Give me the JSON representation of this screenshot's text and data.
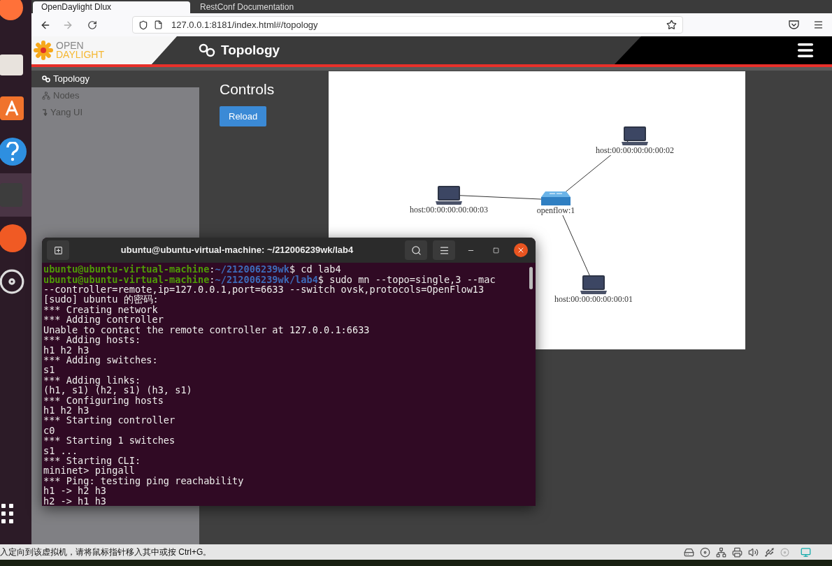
{
  "browser": {
    "tabs": [
      {
        "label": "OpenDaylight Dlux",
        "selected": true
      },
      {
        "label": "RestConf Documentation",
        "selected": false
      }
    ],
    "url": "127.0.0.1:8181/index.html#/topology"
  },
  "app": {
    "logo_top": "OPEN",
    "logo_bottom": "DAYLIGHT",
    "page_title": "Topology"
  },
  "sidebar": {
    "items": [
      {
        "label": "Topology",
        "selected": true
      },
      {
        "label": "Nodes",
        "selected": false
      },
      {
        "label": "Yang UI",
        "selected": false
      }
    ]
  },
  "controls": {
    "title": "Controls",
    "reload_button": "Reload"
  },
  "topology": {
    "nodes": [
      {
        "kind": "host",
        "label": "host:00:00:00:00:00:02"
      },
      {
        "kind": "host",
        "label": "host:00:00:00:00:00:03"
      },
      {
        "kind": "switch",
        "label": "openflow:1"
      },
      {
        "kind": "host",
        "label": "host:00:00:00:00:00:01"
      }
    ]
  },
  "terminal": {
    "title": "ubuntu@ubuntu-virtual-machine: ~/212006239wk/lab4",
    "lines": [
      {
        "kind": "prompt",
        "user": "ubuntu@ubuntu-virtual-machine",
        "colon": ":",
        "path": "~/212006239wk",
        "rest": "$ cd lab4"
      },
      {
        "kind": "prompt",
        "user": "ubuntu@ubuntu-virtual-machine",
        "colon": ":",
        "path": "~/212006239wk/lab4",
        "rest": "$ sudo mn --topo=single,3 --mac"
      },
      {
        "kind": "text",
        "text": "--controller=remote,ip=127.0.0.1,port=6633 --switch ovsk,protocols=OpenFlow13"
      },
      {
        "kind": "text",
        "text": "[sudo] ubuntu 的密码:"
      },
      {
        "kind": "text",
        "text": "*** Creating network"
      },
      {
        "kind": "text",
        "text": "*** Adding controller"
      },
      {
        "kind": "text",
        "text": "Unable to contact the remote controller at 127.0.0.1:6633"
      },
      {
        "kind": "text",
        "text": "*** Adding hosts:"
      },
      {
        "kind": "text",
        "text": "h1 h2 h3"
      },
      {
        "kind": "text",
        "text": "*** Adding switches:"
      },
      {
        "kind": "text",
        "text": "s1"
      },
      {
        "kind": "text",
        "text": "*** Adding links:"
      },
      {
        "kind": "text",
        "text": "(h1, s1) (h2, s1) (h3, s1)"
      },
      {
        "kind": "text",
        "text": "*** Configuring hosts"
      },
      {
        "kind": "text",
        "text": "h1 h2 h3"
      },
      {
        "kind": "text",
        "text": "*** Starting controller"
      },
      {
        "kind": "text",
        "text": "c0"
      },
      {
        "kind": "text",
        "text": "*** Starting 1 switches"
      },
      {
        "kind": "text",
        "text": "s1 ..."
      },
      {
        "kind": "text",
        "text": "*** Starting CLI:"
      },
      {
        "kind": "text",
        "text": "mininet> pingall"
      },
      {
        "kind": "text",
        "text": "*** Ping: testing ping reachability"
      },
      {
        "kind": "text",
        "text": "h1 -> h2 h3"
      },
      {
        "kind": "text",
        "text": "h2 -> h1 h3"
      }
    ]
  },
  "vm_status": {
    "message": "入定向到该虚拟机，请将鼠标指针移入其中或按 Ctrl+G。"
  }
}
